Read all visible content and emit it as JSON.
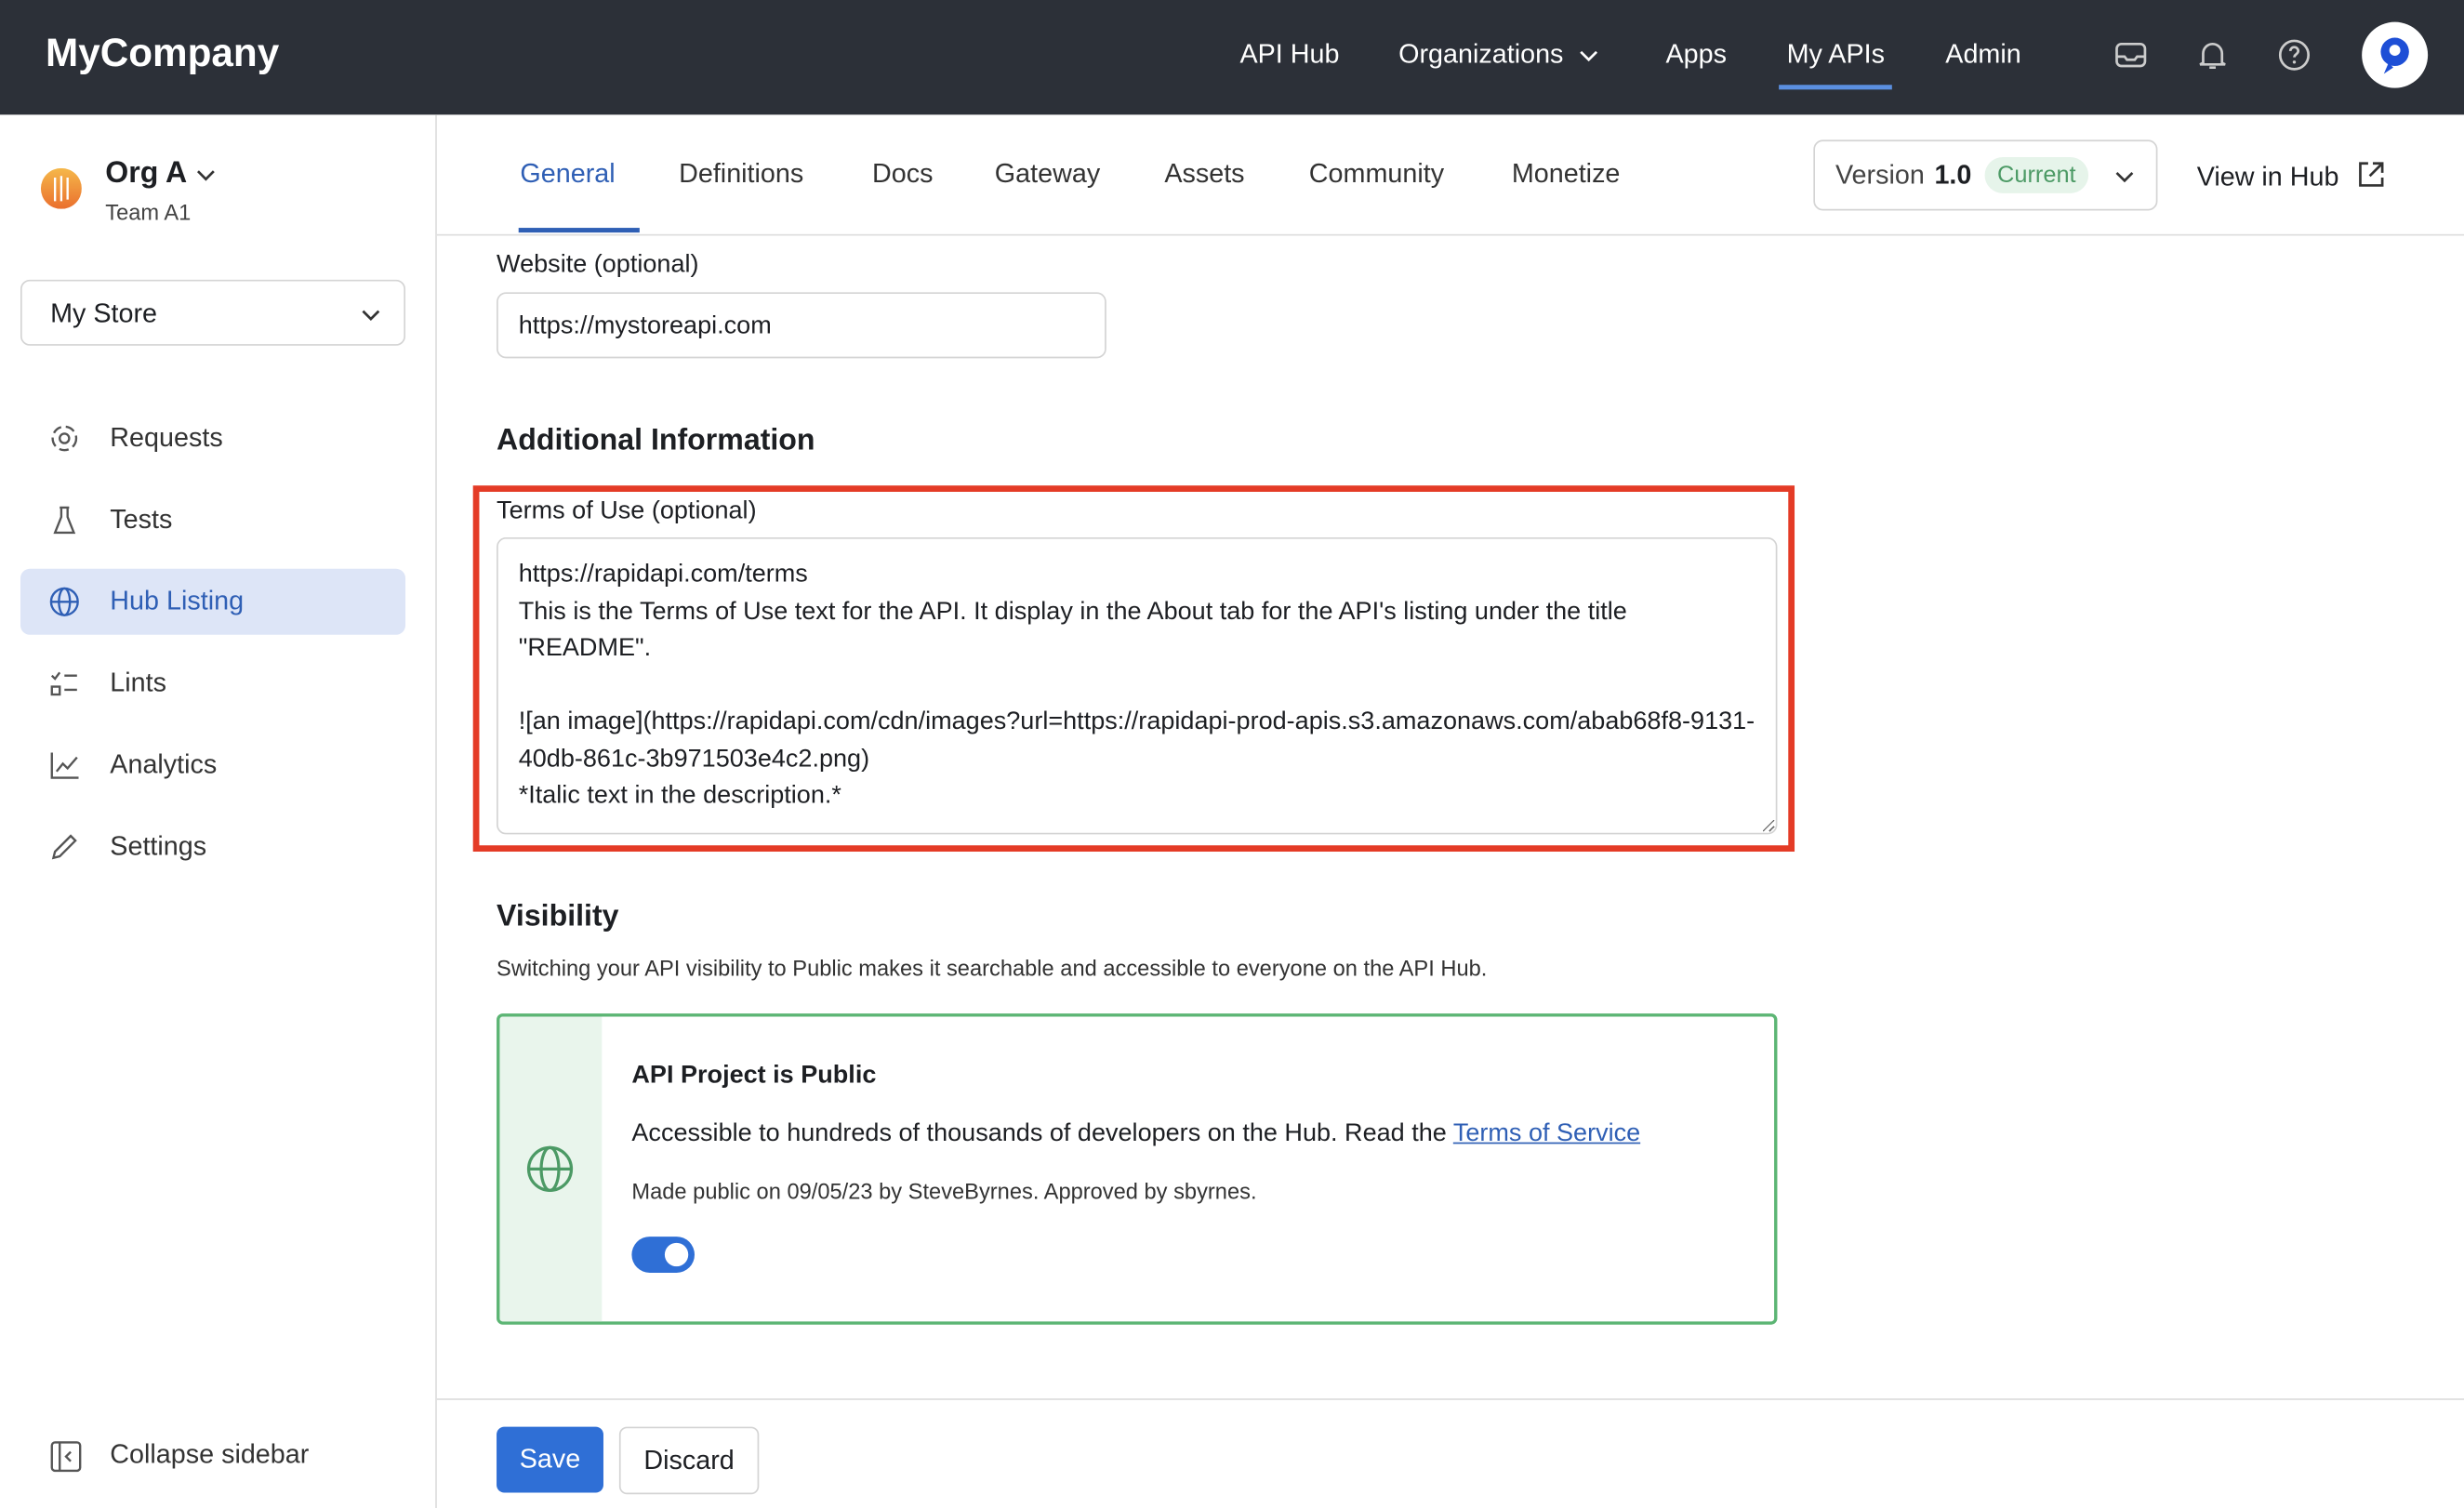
{
  "header": {
    "brand": "MyCompany",
    "nav": [
      {
        "label": "API Hub"
      },
      {
        "label": "Organizations"
      },
      {
        "label": "Apps"
      },
      {
        "label": "My APIs"
      },
      {
        "label": "Admin"
      }
    ],
    "active_nav": "My APIs",
    "icons": [
      "inbox-icon",
      "bell-icon",
      "help-icon",
      "avatar"
    ]
  },
  "sidebar": {
    "org": "Org A",
    "team": "Team A1",
    "project": "My Store",
    "items": [
      {
        "label": "Requests",
        "icon": "requests-icon"
      },
      {
        "label": "Tests",
        "icon": "flask-icon"
      },
      {
        "label": "Hub Listing",
        "icon": "globe-icon"
      },
      {
        "label": "Lints",
        "icon": "lints-icon"
      },
      {
        "label": "Analytics",
        "icon": "chart-icon"
      },
      {
        "label": "Settings",
        "icon": "pencil-icon"
      }
    ],
    "active": "Hub Listing",
    "collapse": "Collapse sidebar"
  },
  "tabs": [
    {
      "label": "General"
    },
    {
      "label": "Definitions"
    },
    {
      "label": "Docs"
    },
    {
      "label": "Gateway"
    },
    {
      "label": "Assets"
    },
    {
      "label": "Community"
    },
    {
      "label": "Monetize"
    }
  ],
  "version": {
    "label": "Version",
    "number": "1.0",
    "badge": "Current"
  },
  "view_in_hub": "View in Hub",
  "form": {
    "website_label": "Website (optional)",
    "website_value": "https://mystoreapi.com",
    "additional_heading": "Additional Information",
    "terms_label": "Terms of Use (optional)",
    "terms_value": "https://rapidapi.com/terms\nThis is the Terms of Use text for the API. It display in the About tab for the API's listing under the title \"README\".\n\n![an image](https://rapidapi.com/cdn/images?url=https://rapidapi-prod-apis.s3.amazonaws.com/abab68f8-9131-40db-861c-3b971503e4c2.png)\n*Italic text in the description.*",
    "visibility_heading": "Visibility",
    "visibility_desc": "Switching your API visibility to Public makes it searchable and accessible to everyone on the API Hub.",
    "public_title": "API Project is Public",
    "public_desc": "Accessible to hundreds of thousands of developers on the Hub. Read the",
    "tos_link": "Terms of Service",
    "public_meta": "Made public on 09/05/23 by SteveByrnes. Approved by sbyrnes.",
    "public_toggle_on": true
  },
  "actions": {
    "save": "Save",
    "discard": "Discard"
  },
  "colors": {
    "accent": "#2f6fd6",
    "header_bg": "#2c3038",
    "highlight": "#e43b26",
    "public_green": "#5cb574"
  }
}
